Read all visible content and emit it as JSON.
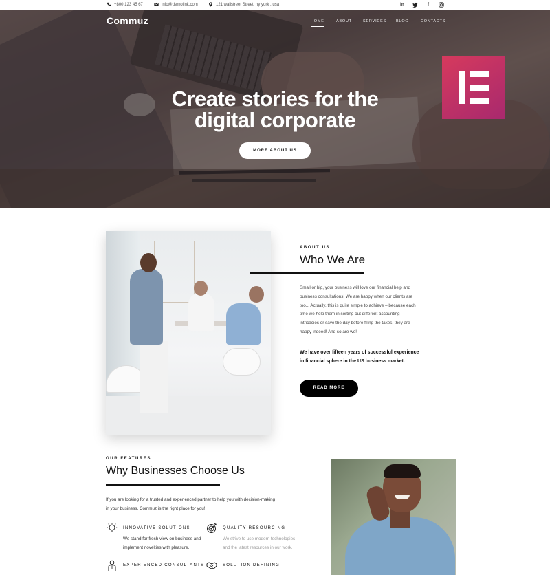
{
  "topbar": {
    "phone": "+800 123 45 67",
    "email": "info@demolink.com",
    "address": "121 wallstreet Street, ny york , usa",
    "socials": [
      "in",
      "t",
      "f",
      "ig"
    ]
  },
  "nav": {
    "logo": "Commuz",
    "items": [
      {
        "label": "HOME",
        "active": true
      },
      {
        "label": "ABOUT"
      },
      {
        "label": "SERVICES"
      },
      {
        "label": "BLOG"
      },
      {
        "label": "CONTACTS"
      }
    ]
  },
  "hero": {
    "title_line1": "Create stories for the",
    "title_line2": "digital corporate",
    "button": "MORE ABOUT US",
    "badge_icon": "elementor-logo-icon",
    "badge_color": "#c2305f"
  },
  "about": {
    "eyebrow": "ABOUT US",
    "title": "Who We Are",
    "text_lines": [
      "Small or big, your business will love our financial help and",
      "business consultations! We are happy when our clients are",
      "too... Actually, this is quite simple to achieve – because each",
      "time we help them in sorting out different accounting",
      "intricacies or save the day before filing the taxes, they are",
      "happy indeed! And so are we!"
    ],
    "bold_lines": [
      "We have over fifteen years of successful experience",
      "in financial sphere in the US business market."
    ],
    "button": "READ MORE"
  },
  "features": {
    "eyebrow": "OUR FEATURES",
    "title": "Why Businesses Choose Us",
    "intro_lines": [
      "If you are looking for a trusted and experienced partner to help you with decision-making",
      "in your business, Commuz is the right place for you!"
    ],
    "items": [
      {
        "icon": "lightbulb-icon",
        "title": "INNOVATIVE SOLUTIONS",
        "desc_lines": [
          "We stand for fresh view on business and",
          "implement novelties with pleasure."
        ]
      },
      {
        "icon": "target-icon",
        "title": "QUALITY RESOURCING",
        "desc_lines": [
          "We strive to use modern technologies",
          "and the latest resources in our work."
        ]
      },
      {
        "icon": "consultant-icon",
        "title": "EXPERIENCED CONSULTANTS",
        "desc_lines": []
      },
      {
        "icon": "handshake-icon",
        "title": "SOLUTION DEFINING",
        "desc_lines": []
      }
    ]
  },
  "colors": {
    "accent": "#000000",
    "badge_gradient_start": "#d63a5d",
    "badge_gradient_end": "#a8296e"
  }
}
